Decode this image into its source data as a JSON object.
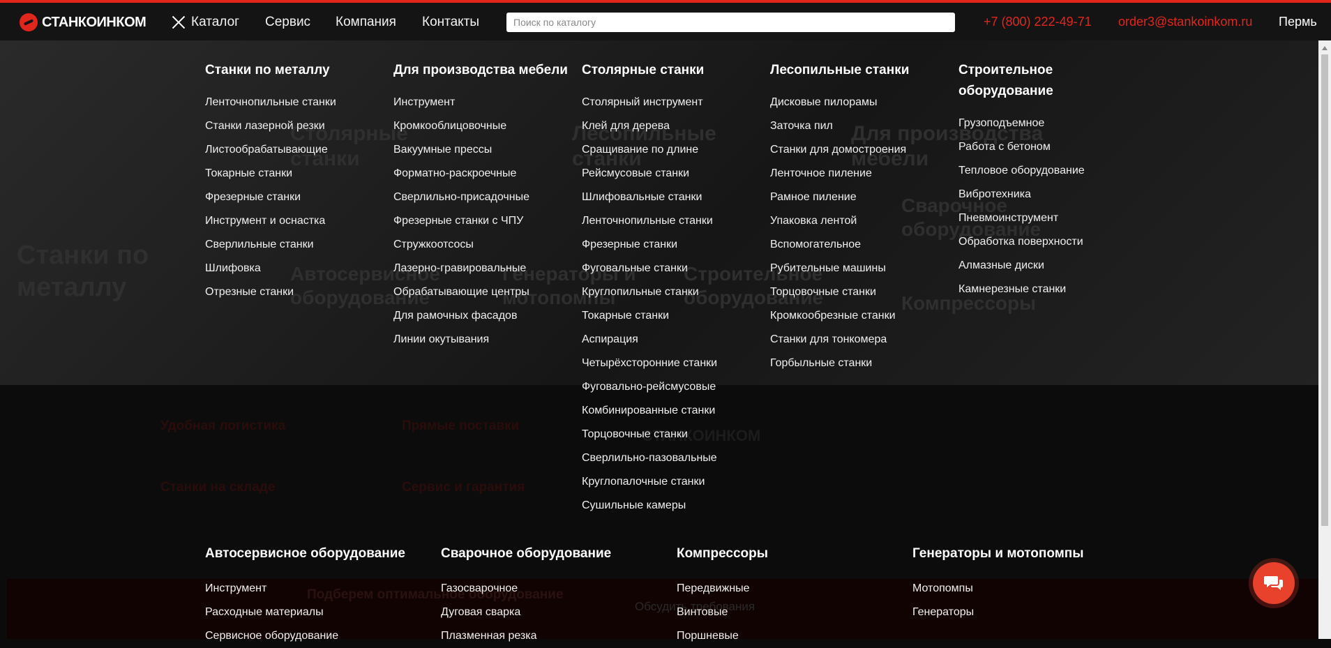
{
  "header": {
    "logo_text": "СТАНКОИНКОМ",
    "nav": {
      "catalog": "Каталог",
      "service": "Сервис",
      "company": "Компания",
      "contacts": "Контакты"
    },
    "search_placeholder": "Поиск по каталогу",
    "phone": "+7 (800) 222-49-71",
    "email": "order3@stankoinkom.ru",
    "city": "Пермь"
  },
  "colors": {
    "accent": "#e3261c",
    "header_bg": "#141414",
    "menu_bg": "#0b0b0b"
  },
  "menu": {
    "top": [
      {
        "title": "Станки по металлу",
        "items": [
          "Ленточнопильные станки",
          "Станки лазерной резки",
          "Листообрабатывающие",
          "Токарные станки",
          "Фрезерные станки",
          "Инструмент и оснастка",
          "Сверлильные станки",
          "Шлифовка",
          "Отрезные станки"
        ]
      },
      {
        "title": "Для производства мебели",
        "items": [
          "Инструмент",
          "Кромкооблицовочные",
          "Вакуумные прессы",
          "Форматно-раскроечные",
          "Сверлильно-присадочные",
          "Фрезерные станки с ЧПУ",
          "Стружкоотсосы",
          "Лазерно-гравировальные",
          "Обрабатывающие центры",
          "Для рамочных фасадов",
          "Линии окутывания"
        ]
      },
      {
        "title": "Столярные станки",
        "items": [
          "Столярный инструмент",
          "Клей для дерева",
          "Сращивание по длине",
          "Рейсмусовые станки",
          "Шлифовальные станки",
          "Ленточнопильные станки",
          "Фрезерные станки",
          "Фуговальные станки",
          "Круглопильные станки",
          "Токарные станки",
          "Аспирация",
          "Четырёхсторонние станки",
          "Фуговально-рейсмусовые",
          "Комбинированные станки",
          "Торцовочные станки",
          "Сверлильно-пазовальные",
          "Круглопалочные станки",
          "Сушильные камеры"
        ]
      },
      {
        "title": "Лесопильные станки",
        "items": [
          "Дисковые пилорамы",
          "Заточка пил",
          "Станки для домостроения",
          "Ленточное пиление",
          "Рамное пиление",
          "Упаковка лентой",
          "Вспомогательное",
          "Рубительные машины",
          "Торцовочные станки",
          "Кромкообрезные станки",
          "Станки для тонкомера",
          "Горбыльные станки"
        ]
      },
      {
        "title": "Строительное оборудование",
        "items": [
          "Грузоподъемное",
          "Работа с бетоном",
          "Тепловое оборудование",
          "Вибротехника",
          "Пневмоинструмент",
          "Обработка поверхности",
          "Алмазные диски",
          "Камнерезные станки"
        ]
      }
    ],
    "bottom": [
      {
        "title": "Автосервисное оборудование",
        "items": [
          "Инструмент",
          "Расходные материалы",
          "Сервисное оборудование"
        ]
      },
      {
        "title": "Сварочное оборудование",
        "items": [
          "Газосварочное",
          "Дуговая сварка",
          "Плазменная резка"
        ]
      },
      {
        "title": "Компрессоры",
        "items": [
          "Передвижные",
          "Винтовые",
          "Поршневые"
        ]
      },
      {
        "title": "Генераторы и мотопомпы",
        "items": [
          "Мотопомпы",
          "Генераторы"
        ]
      }
    ]
  },
  "background": {
    "tiles": [
      "Станки по металлу",
      "Столярные станки",
      "Лесопильные станки",
      "Для производства мебели",
      "Сварочное оборудование",
      "Автосервисное оборудование",
      "Генераторы и мотопомпы",
      "Строительное оборудование",
      "Компрессоры"
    ],
    "features": [
      "Удобная логистика",
      "Прямые поставки",
      "Станки на складе",
      "Сервис и гарантия"
    ],
    "promo": "Подберем оптимальное оборудование",
    "discuss": "Обсудить требования"
  }
}
